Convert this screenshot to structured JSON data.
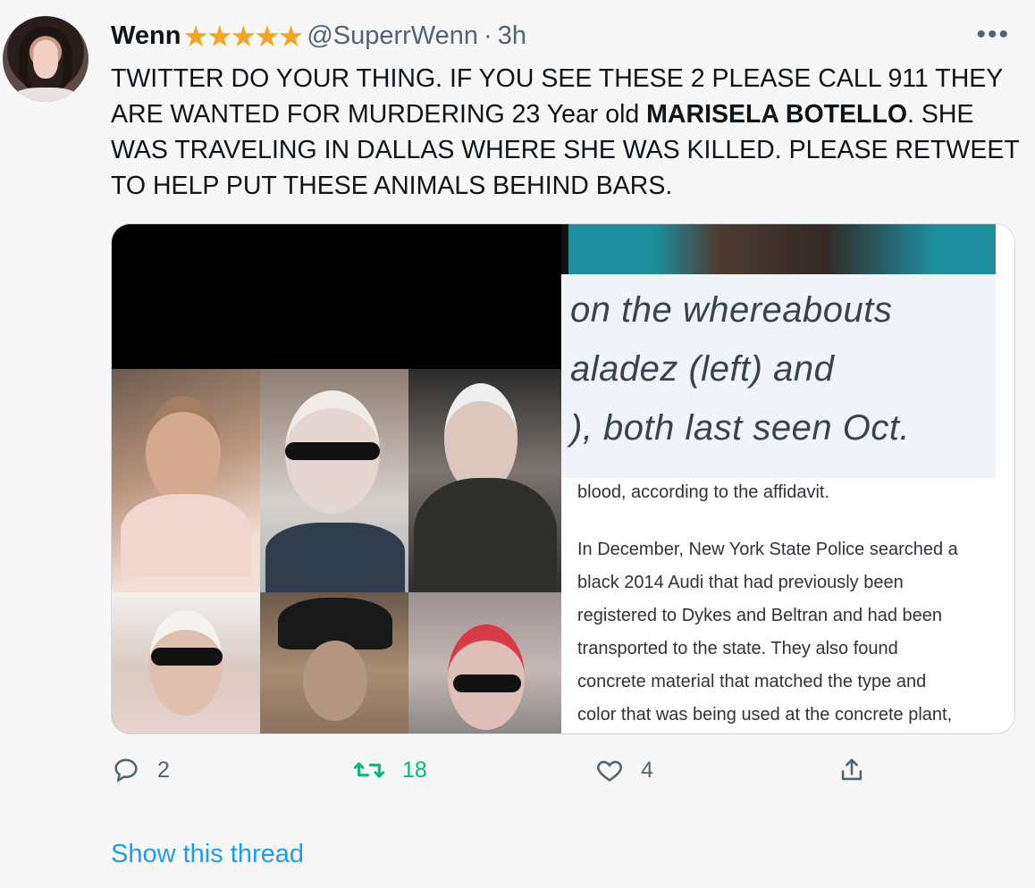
{
  "tweet": {
    "author_name": "Wenn",
    "stars": "★★★★★",
    "handle": "@SuperrWenn",
    "separator": "·",
    "time": "3h",
    "more": "•••",
    "text_before": "TWITTER DO YOUR THING. IF YOU SEE THESE 2 PLEASE CALL 911 THEY ARE WANTED FOR MURDERING 23 Year old ",
    "text_bold": "MARISELA BOTELLO",
    "text_after": ". SHE WAS TRAVELING IN DALLAS WHERE SHE WAS KILLED. PLEASE RETWEET TO HELP PUT THESE ANIMALS BEHIND BARS."
  },
  "media": {
    "quote_lines": [
      "on the whereabouts",
      "aladez (left) and",
      "), both last seen Oct."
    ],
    "article_lines": [
      "blood, according to the affidavit.",
      "In December, New York State Police searched a",
      "black 2014 Audi that had previously been",
      "registered to Dykes and Beltran and had been",
      "transported to the state. They also found",
      "concrete material that matched the type and",
      "color that was being used at the concrete plant,"
    ]
  },
  "actions": {
    "reply_count": "2",
    "retweet_count": "18",
    "like_count": "4"
  },
  "footer": {
    "show_thread": "Show this thread"
  },
  "colors": {
    "star": "#f4a422",
    "secondary": "#536471",
    "retweet": "#00ba7c",
    "link": "#1d9bf0"
  }
}
